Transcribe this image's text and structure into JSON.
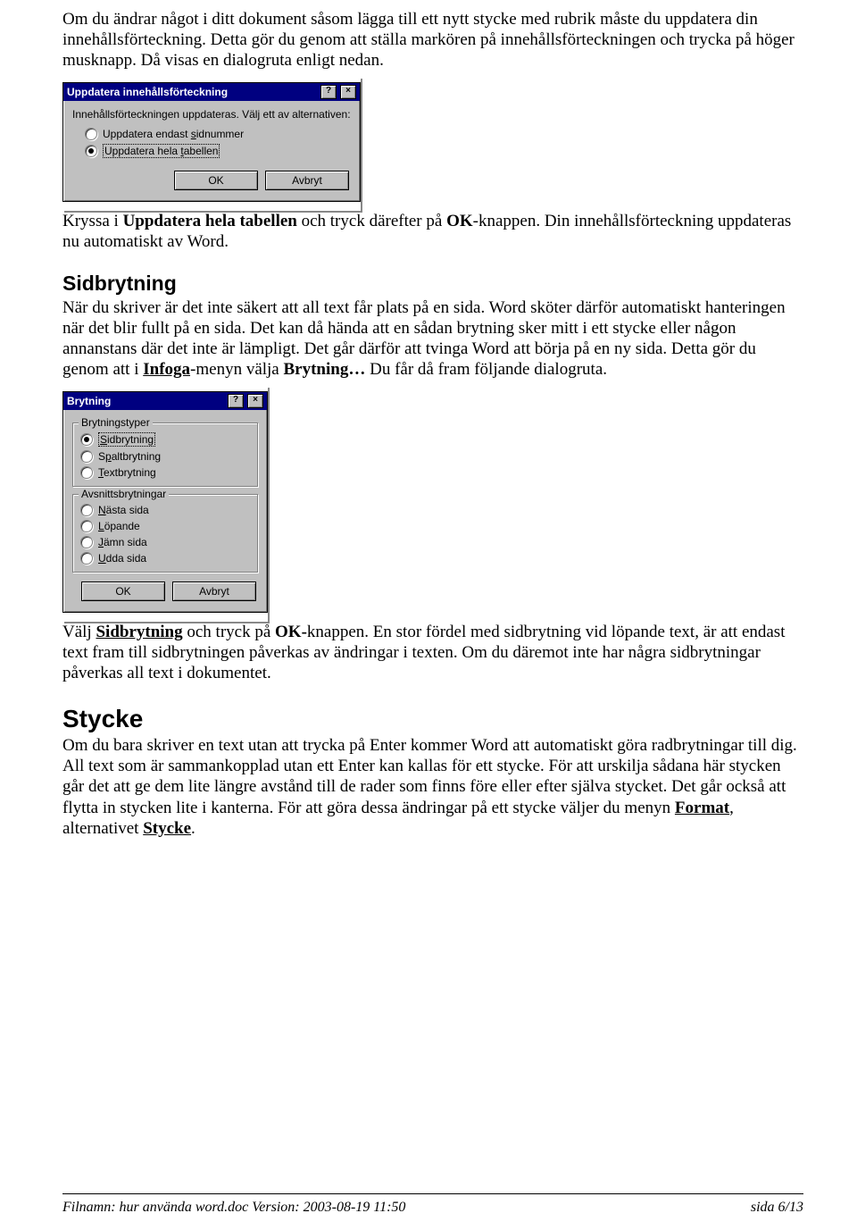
{
  "paragraphs": {
    "intro": "Om du ändrar något i ditt dokument såsom lägga till ett nytt stycke med rubrik måste du uppdatera din innehållsförteckning. Detta gör du genom att ställa markören på innehållsförteckningen och trycka på höger musknapp. Då visas en dialogruta enligt nedan.",
    "after_dialog1_a": "Kryssa i ",
    "after_dialog1_b": "Uppdatera hela tabellen",
    "after_dialog1_c": " och tryck därefter på ",
    "after_dialog1_d": "OK",
    "after_dialog1_e": "-knappen. Din innehållsförteckning uppdateras nu automatiskt av Word.",
    "sidbrytning_body_a": "När du skriver är det inte säkert att all text får plats på en sida. Word sköter därför automatiskt hanteringen när det blir fullt på en sida. Det kan då hända att en sådan brytning sker mitt i ett stycke eller någon annanstans där det inte är lämpligt. Det går därför att tvinga Word att börja på en ny sida. Detta gör du genom att i ",
    "sidbrytning_body_infoga": "Infoga",
    "sidbrytning_body_b": "-menyn välja ",
    "sidbrytning_body_brytning": "Brytning…",
    "sidbrytning_body_c": " Du får då fram följande dialogruta.",
    "after_dialog2_a": "Välj ",
    "after_dialog2_sid": "Sidbrytning",
    "after_dialog2_b": " och tryck på ",
    "after_dialog2_ok": "OK-",
    "after_dialog2_c": "knappen. En stor fördel med sidbrytning vid löpande text, är att endast text fram till sidbrytningen påverkas av ändringar i texten. Om du däremot inte har några sidbrytningar påverkas all text i dokumentet.",
    "stycke_body_a": "Om du bara skriver en text utan att trycka på Enter kommer Word att automatiskt göra radbrytningar till dig. All text som är sammankopplad utan ett Enter kan kallas för ett stycke. För att urskilja sådana här stycken går det att ge dem lite längre avstånd till de rader som finns före eller efter själva stycket. Det går också att flytta in stycken lite i kanterna. För att göra dessa ändringar på ett stycke väljer du menyn ",
    "stycke_format": "Format",
    "stycke_body_b": ", alternativet ",
    "stycke_stycke": "Stycke",
    "stycke_body_c": "."
  },
  "headings": {
    "sidbrytning": "Sidbrytning",
    "stycke": "Stycke"
  },
  "dialog1": {
    "title": "Uppdatera innehållsförteckning",
    "help_btn": "?",
    "close_btn": "×",
    "prompt": "Innehållsförteckningen uppdateras. Välj ett av alternativen:",
    "opt_pages_pre": "Uppdatera endast ",
    "opt_pages_key": "s",
    "opt_pages_post": "idnummer",
    "opt_table_pre": "Uppdatera hela ",
    "opt_table_key": "t",
    "opt_table_post": "abellen",
    "ok": "OK",
    "cancel": "Avbryt"
  },
  "dialog2": {
    "title": "Brytning",
    "help_btn": "?",
    "close_btn": "×",
    "group1_legend": "Brytningstyper",
    "opt_sid_key": "S",
    "opt_sid_post": "idbrytning",
    "opt_spalt_pre": "S",
    "opt_spalt_key": "p",
    "opt_spalt_post": "altbrytning",
    "opt_text_key": "T",
    "opt_text_post": "extbrytning",
    "group2_legend": "Avsnittsbrytningar",
    "opt_nasta_key": "N",
    "opt_nasta_post": "ästa sida",
    "opt_lopande_key": "L",
    "opt_lopande_post": "öpande",
    "opt_jamn_key": "J",
    "opt_jamn_post": "ämn sida",
    "opt_udda_key": "U",
    "opt_udda_post": "dda sida",
    "ok": "OK",
    "cancel": "Avbryt"
  },
  "footer": {
    "left": "Filnamn: hur använda word.doc  Version: 2003-08-19 11:50",
    "right": "sida 6/13"
  }
}
